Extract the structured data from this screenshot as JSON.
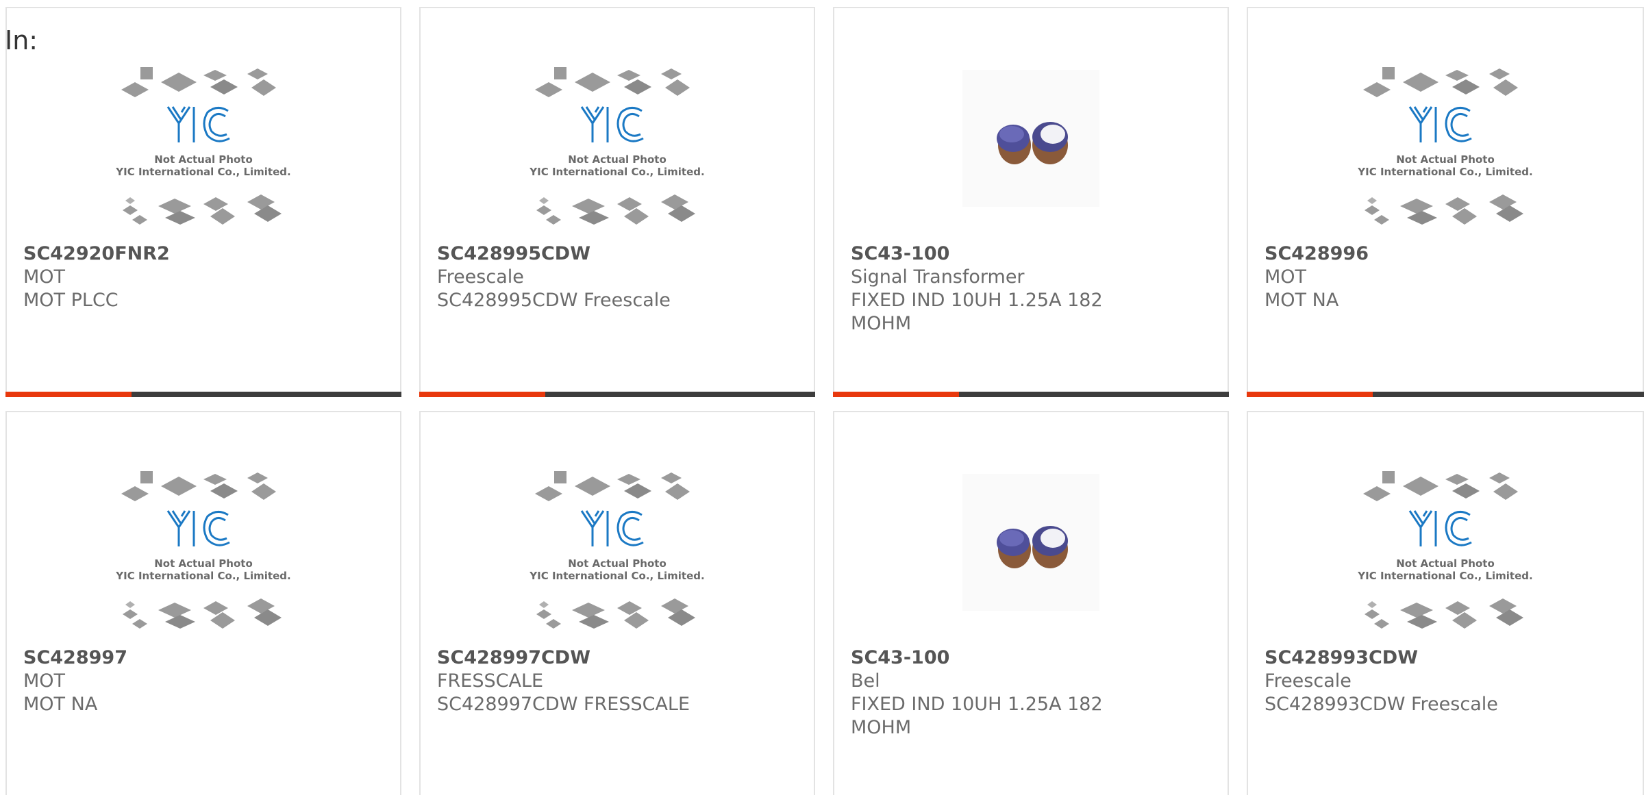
{
  "header": {
    "label": "In:"
  },
  "colors": {
    "accent": "#e8380d",
    "bar": "#3d3d3d",
    "logo": "#1b79c4"
  },
  "placeholder": {
    "line1": "Not Actual Photo",
    "line2": "YIC International Co., Limited."
  },
  "products": [
    {
      "part_number": "SC42920FNR2",
      "manufacturer": "MOT",
      "description": "MOT PLCC",
      "image": "placeholder"
    },
    {
      "part_number": "SC428995CDW",
      "manufacturer": "Freescale",
      "description": "SC428995CDW Freescale",
      "image": "placeholder"
    },
    {
      "part_number": "SC43-100",
      "manufacturer": "Signal Transformer",
      "description": "FIXED IND 10UH 1.25A 182 MOHM",
      "image": "inductor"
    },
    {
      "part_number": "SC428996",
      "manufacturer": "MOT",
      "description": "MOT NA",
      "image": "placeholder"
    },
    {
      "part_number": "SC428997",
      "manufacturer": "MOT",
      "description": "MOT NA",
      "image": "placeholder"
    },
    {
      "part_number": "SC428997CDW",
      "manufacturer": "FRESSCALE",
      "description": "SC428997CDW FRESSCALE",
      "image": "placeholder"
    },
    {
      "part_number": "SC43-100",
      "manufacturer": "Bel",
      "description": "FIXED IND 10UH 1.25A 182 MOHM",
      "image": "inductor"
    },
    {
      "part_number": "SC428993CDW",
      "manufacturer": "Freescale",
      "description": "SC428993CDW Freescale",
      "image": "placeholder"
    }
  ]
}
